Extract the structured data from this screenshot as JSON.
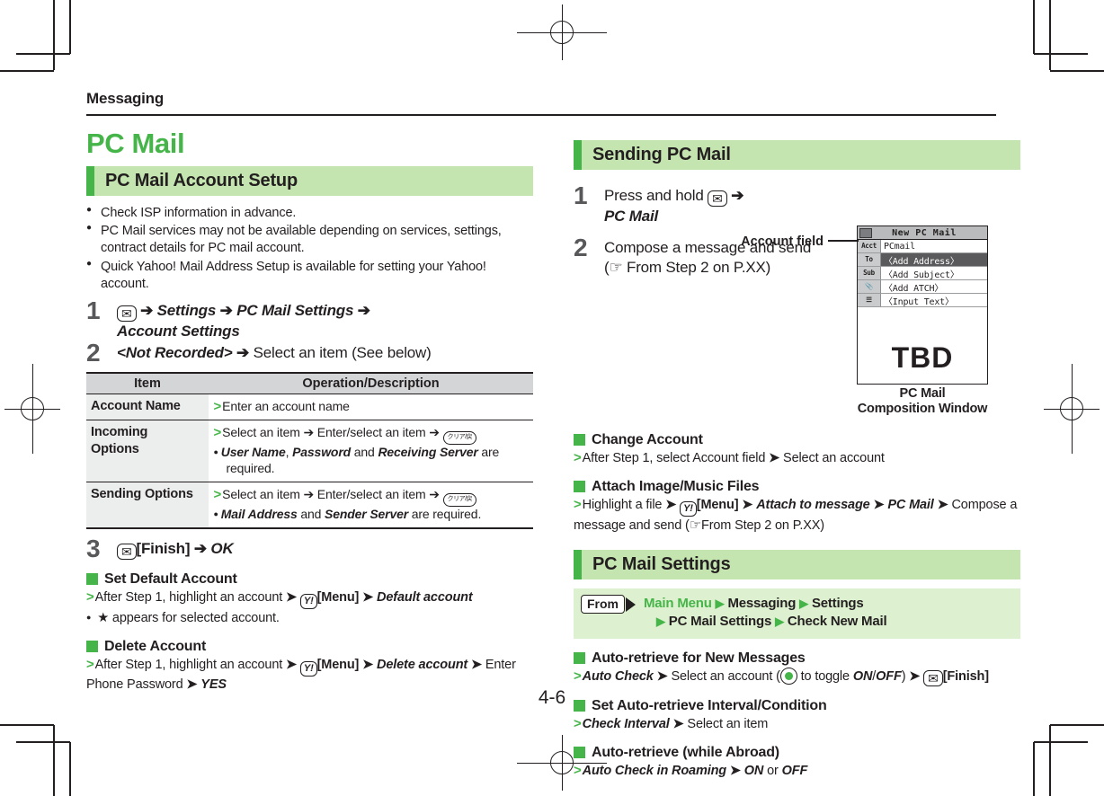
{
  "page": {
    "running_head": "Messaging",
    "page_number": "4-6"
  },
  "left": {
    "chapter_title": "PC Mail",
    "section_title": "PC Mail Account Setup",
    "notes": [
      "Check ISP information in advance.",
      "PC Mail services may not be available depending on services, settings, contract details for PC mail account.",
      "Quick Yahoo! Mail Address Setup is available for setting your Yahoo! account."
    ],
    "step1": {
      "number": "1",
      "key": "mail-key",
      "a1": "➔",
      "t1": "Settings",
      "a2": "➔",
      "t2": "PC Mail Settings",
      "a3": "➔",
      "t3": "Account Settings"
    },
    "step2": {
      "number": "2",
      "t1": "<Not Recorded>",
      "a1": "➔",
      "t2": "Select an item (See below)"
    },
    "table": {
      "headers": [
        "Item",
        "Operation/Description"
      ],
      "rows": [
        {
          "item": "Account Name",
          "lines": [
            {
              "marker": ">",
              "text": "Enter an account name"
            }
          ]
        },
        {
          "item": "Incoming Options",
          "lines": [
            {
              "marker": ">",
              "text": "Select an item ➔ Enter/select an item ➔",
              "key": "clear-key"
            },
            {
              "marker": "●",
              "text": "User Name, Password and Receiving Server are required."
            }
          ]
        },
        {
          "item": "Sending Options",
          "lines": [
            {
              "marker": ">",
              "text": "Select an item ➔ Enter/select an item ➔",
              "key": "clear-key"
            },
            {
              "marker": "●",
              "text": "Mail Address and Sender Server are required."
            }
          ]
        }
      ]
    },
    "step3": {
      "number": "3",
      "key": "mail-key",
      "t1": "[Finish]",
      "a1": "➔",
      "t2": "OK"
    },
    "sub_sections": [
      {
        "heading": "Set Default Account",
        "lines": [
          "After Step 1, highlight an account ➔ [Menu] ➔ Default account",
          "★ appears for selected account."
        ]
      },
      {
        "heading": "Delete Account",
        "lines": [
          "After Step 1, highlight an account ➔ [Menu] ➔ Delete account ➔ Enter Phone Password ➔ YES"
        ]
      }
    ]
  },
  "right": {
    "sending_section_title": "Sending PC Mail",
    "step1": {
      "number": "1",
      "pre": "Press and hold",
      "key": "mail-key",
      "a1": "➔",
      "t1": "PC Mail"
    },
    "step2": {
      "number": "2",
      "l1": "Compose a message and send",
      "l2": "(☞ From Step 2 on P.XX)"
    },
    "callout_label": "Account field",
    "phone": {
      "title": "New PC Mail",
      "rows": [
        {
          "label": "Acct",
          "value": "PCmail",
          "selected": false
        },
        {
          "label": "To",
          "value": "〈Add Address〉",
          "selected": true
        },
        {
          "label": "Sub",
          "value": "〈Add Subject〉",
          "selected": false
        },
        {
          "label": "clip",
          "value": "〈Add ATCH〉",
          "selected": false
        },
        {
          "label": "text",
          "value": "〈Input Text〉",
          "selected": false
        }
      ],
      "tbd": "TBD"
    },
    "shot_caption_1": "PC Mail",
    "shot_caption_2": "Composition Window",
    "sub_sections": [
      {
        "heading": "Change Account",
        "lines": [
          "After Step 1, select Account field ➔ Select an account"
        ]
      },
      {
        "heading": "Attach Image/Music Files",
        "lines": [
          "Highlight a file ➔ [Menu] ➔ Attach to message ➔ PC Mail ➔ Compose a message and send (☞ From Step 2 on P.XX)"
        ]
      }
    ],
    "settings_section_title": "PC Mail Settings",
    "from": {
      "tag": "From",
      "crumbs_line1": [
        "Main Menu",
        "Messaging",
        "Settings"
      ],
      "crumbs_line2": [
        "PC Mail Settings",
        "Check New Mail"
      ]
    },
    "settings_items": [
      {
        "heading": "Auto-retrieve for New Messages",
        "line": "Auto Check ➔ Select an account ( to toggle ON/OFF) ➔ [Finish]"
      },
      {
        "heading": "Set Auto-retrieve Interval/Condition",
        "line": "Check Interval ➔ Select an item"
      },
      {
        "heading": "Auto-retrieve (while Abroad)",
        "line": "Auto Check in Roaming ➔ ON or OFF"
      }
    ]
  },
  "colors": {
    "accent_green": "#46b549",
    "band_green": "#c5e5b0",
    "from_green": "#ddf0cf",
    "ink": "#231f20",
    "table_header_gray": "#d4d5d7",
    "table_item_gray": "#eceded"
  }
}
